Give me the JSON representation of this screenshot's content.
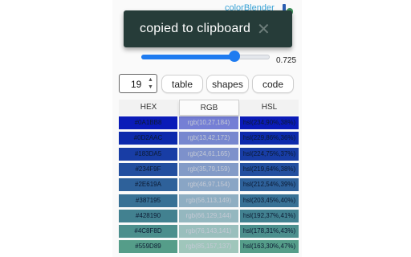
{
  "app": {
    "brand": "colorBlender"
  },
  "toast": {
    "message": "copied to clipboard",
    "close_glyph": "✕"
  },
  "slider": {
    "value_label": "0.725",
    "fraction": 0.725
  },
  "stepper": {
    "value": "19"
  },
  "toolbar": {
    "table_label": "table",
    "shapes_label": "shapes",
    "code_label": "code"
  },
  "columns": {
    "hex": "HEX",
    "rgb": "RGB",
    "hsl": "HSL"
  },
  "rows": [
    {
      "hex": "#0A1BB8",
      "rgb": "rgb(10,27,184)",
      "hsl": "hsl(234,90%,38%)",
      "color": "#0A1BB8"
    },
    {
      "hex": "#0D2AAC",
      "rgb": "rgb(13,42,172)",
      "hsl": "hsl(229,86%,36%)",
      "color": "#0D2AAC"
    },
    {
      "hex": "#183DA5",
      "rgb": "rgb(24,61,165)",
      "hsl": "hsl(224,75%,37%)",
      "color": "#183DA5"
    },
    {
      "hex": "#234F9F",
      "rgb": "rgb(35,79,159)",
      "hsl": "hsl(219,64%,38%)",
      "color": "#234F9F"
    },
    {
      "hex": "#2E619A",
      "rgb": "rgb(46,97,154)",
      "hsl": "hsl(212,54%,39%)",
      "color": "#2E619A"
    },
    {
      "hex": "#387195",
      "rgb": "rgb(56,113,149)",
      "hsl": "hsl(203,45%,40%)",
      "color": "#387195"
    },
    {
      "hex": "#428190",
      "rgb": "rgb(66,129,144)",
      "hsl": "hsl(192,37%,41%)",
      "color": "#428190"
    },
    {
      "hex": "#4C8F8D",
      "rgb": "rgb(76,143,141)",
      "hsl": "hsl(178,31%,43%)",
      "color": "#4C8F8D"
    },
    {
      "hex": "#559D89",
      "rgb": "rgb(85,157,137)",
      "hsl": "hsl(163,30%,47%)",
      "color": "#559D89"
    }
  ]
}
